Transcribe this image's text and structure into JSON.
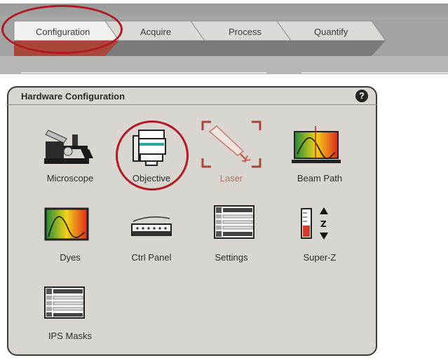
{
  "tabs": [
    {
      "label": "Configuration",
      "active": true
    },
    {
      "label": "Acquire",
      "active": false
    },
    {
      "label": "Process",
      "active": false
    },
    {
      "label": "Quantify",
      "active": false
    }
  ],
  "panel": {
    "title": "Hardware Configuration",
    "help_label": "?"
  },
  "tools": [
    {
      "label": "Microscope",
      "icon": "microscope-icon",
      "enabled": true
    },
    {
      "label": "Objective",
      "icon": "objective-icon",
      "enabled": true
    },
    {
      "label": "Laser",
      "icon": "laser-icon",
      "enabled": false
    },
    {
      "label": "Beam Path",
      "icon": "beam-path-icon",
      "enabled": true
    },
    {
      "label": "Dyes",
      "icon": "dyes-spectrum-icon",
      "enabled": true
    },
    {
      "label": "Ctrl Panel",
      "icon": "control-panel-icon",
      "enabled": true
    },
    {
      "label": "Settings",
      "icon": "settings-list-icon",
      "enabled": true
    },
    {
      "label": "Super-Z",
      "icon": "super-z-icon",
      "enabled": true
    },
    {
      "label": "IPS Masks",
      "icon": "ips-masks-icon",
      "enabled": true
    }
  ],
  "annotation_color": "#b01a22",
  "active_tab_color": "#a9483a"
}
